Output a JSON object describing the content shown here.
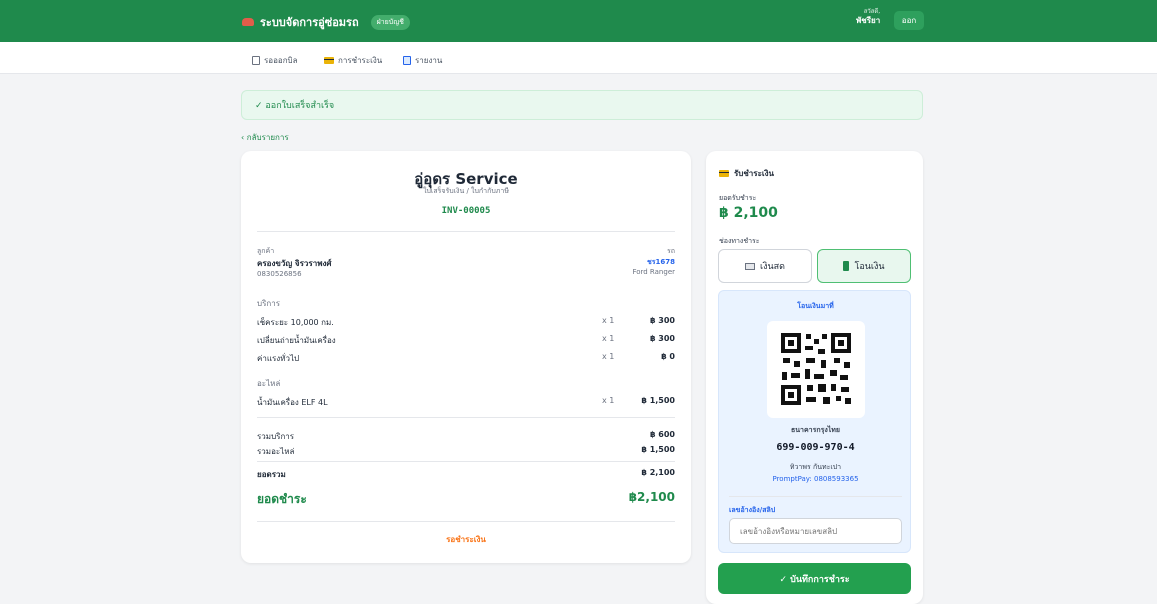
{
  "app": {
    "title": "ระบบจัดการอู่ซ่อมรถ",
    "badge": "ฝ่ายบัญชี",
    "user_greeting": "สวัสดี,",
    "user_name": "พัชรียา",
    "logout": "ออก"
  },
  "nav": {
    "tabs": [
      "รอออกบิล",
      "การชำระเงิน",
      "รายงาน"
    ]
  },
  "page": {
    "success_message": "✓ ออกใบเสร็จสำเร็จ",
    "back_link": "‹ กลับรายการ"
  },
  "receipt": {
    "shop_name": "อู่อุดร Service",
    "subtitle": "ใบเสร็จรับเงิน / ใบกำกับภาษี",
    "invoice_no": "INV-00005",
    "customer_label": "ลูกค้า",
    "customer_name": "ครองขวัญ จิรวราพงศ์",
    "customer_phone": "0830526856",
    "vehicle_label": "รถ",
    "vehicle_plate": "ชร1678",
    "vehicle_model": "Ford Ranger",
    "services_heading": "บริการ",
    "services": [
      {
        "name": "เช็คระยะ 10,000 กม.",
        "qty": "x 1",
        "price": "฿ 300"
      },
      {
        "name": "เปลี่ยนถ่ายน้ำมันเครื่อง",
        "qty": "x 1",
        "price": "฿ 300"
      },
      {
        "name": "ค่าแรงทั่วไป",
        "qty": "x 1",
        "price": "฿ 0"
      }
    ],
    "parts_heading": "อะไหล่",
    "parts": [
      {
        "name": "น้ำมันเครื่อง ELF 4L",
        "qty": "x 1",
        "price": "฿ 1,500"
      }
    ],
    "service_total_label": "รวมบริการ",
    "service_total": "฿ 600",
    "parts_total_label": "รวมอะไหล่",
    "parts_total": "฿ 1,500",
    "grand_total_label": "ยอดรวม",
    "grand_total": "฿ 2,100",
    "due_label": "ยอดชำระ",
    "due_total": "฿2,100",
    "status": "รอชำระเงิน"
  },
  "payment": {
    "title": "รับชำระเงิน",
    "amount_label": "ยอดรับชำระ",
    "amount": "฿ 2,100",
    "channel_label": "ช่องทางชำระ",
    "methods": [
      "เงินสด",
      "โอนเงิน"
    ],
    "selected_method": "โอนเงิน",
    "transfer_title": "โอนเงินมาที่",
    "bank": "ธนาคารกรุงไทย",
    "account": "699-009-970-4",
    "holder": "ทิวาพร กันทะเปา",
    "promptpay": "PromptPay: 0808593365",
    "ref_label": "เลขอ้างอิง/สลิป",
    "ref_placeholder": "เลขอ้างอิงหรือหมายเลขสลิป",
    "save_button": "✓ บันทึกการชำระ"
  },
  "colors": {
    "primary": "#1f8a4c",
    "blue": "#2563eb",
    "orange": "#f97316",
    "success_bg": "#e9f8ef"
  }
}
